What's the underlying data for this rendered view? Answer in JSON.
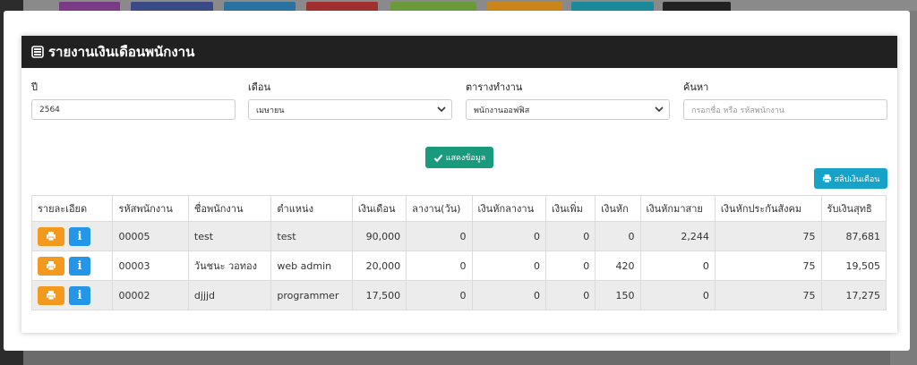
{
  "header": {
    "title": "รายงานเงินเดือนพนักงาน"
  },
  "filters": {
    "year": {
      "label": "ปี",
      "value": "2564"
    },
    "month": {
      "label": "เดือน",
      "value": "เมษายน"
    },
    "schedule": {
      "label": "ตารางทำงาน",
      "value": "พนักงานออฟฟิส"
    },
    "search": {
      "label": "ค้นหา",
      "placeholder": "กรอกชื่อ หรือ รหัสพนักงาน"
    }
  },
  "buttons": {
    "show_label": "แสดงข้อมูล",
    "slip_label": "สลิปเงินเดือน"
  },
  "table": {
    "columns": [
      "รายละเอียด",
      "รหัสพนักงาน",
      "ชื่อพนักงาน",
      "ตำแหน่ง",
      "เงินเดือน",
      "ลางาน(วัน)",
      "เงินหักลางาน",
      "เงินเพิ่ม",
      "เงินหัก",
      "เงินหักมาสาย",
      "เงินหักประกันสังคม",
      "รับเงินสุทธิ"
    ],
    "rows": [
      [
        "00005",
        "test",
        "test",
        "90,000",
        "0",
        "0",
        "0",
        "0",
        "2,244",
        "75",
        "87,681"
      ],
      [
        "00003",
        "วันชนะ วอทอง",
        "web admin",
        "20,000",
        "0",
        "0",
        "0",
        "420",
        "0",
        "75",
        "19,505"
      ],
      [
        "00002",
        "djjjd",
        "programmer",
        "17,500",
        "0",
        "0",
        "0",
        "150",
        "0",
        "75",
        "17,275"
      ]
    ]
  },
  "colors": {
    "header_bg": "#212121",
    "show_button": "#1a9a7d",
    "slip_button": "#17a2c7",
    "print_button": "#f39a1e",
    "info_button": "#2496e8"
  },
  "icons": {
    "header": "list-report-icon",
    "show": "check-icon",
    "slip": "printer-icon",
    "row_print": "printer-icon",
    "row_info": "info-icon"
  }
}
